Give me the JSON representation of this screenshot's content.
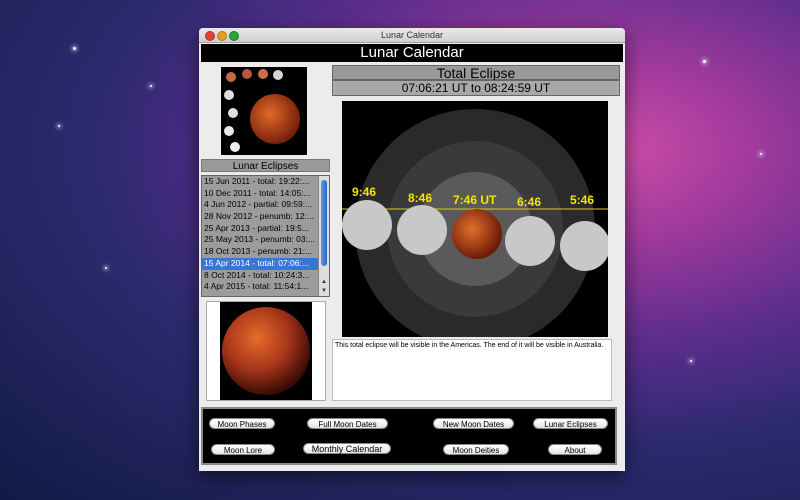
{
  "window": {
    "title": "Lunar Calendar"
  },
  "header": {
    "title": "Lunar Calendar"
  },
  "left": {
    "section_title": "Lunar Eclipses",
    "eclipses": [
      "15 Jun 2011 - total: 19:22:...",
      "10 Dec 2011 - total: 14:05:...",
      "4 Jun 2012 - partial: 09:59:...",
      "28 Nov 2012 - penumb: 12:...",
      "25 Apr 2013 - partial: 19:5...",
      "25 May 2013 - penumb: 03:...",
      "18 Oct 2013 - penumb: 21:...",
      "15 Apr 2014 - total: 07:06:...",
      "8 Oct 2014 - total: 10:24:3...",
      "4 Apr 2015 - total: 11:54:1..."
    ],
    "selected_index": 7
  },
  "eclipse": {
    "type_title": "Total Eclipse",
    "time_range": "07:06:21 UT to 08:24:59 UT",
    "time_labels": [
      "9:46",
      "8:46",
      "7:46 UT",
      "6:46",
      "5:46"
    ],
    "label_color": "#f5e500",
    "moon_color": "#c0521c",
    "description": "This total eclipse will be visible in the Americas. The end of it  will be visible in Australia."
  },
  "buttons": {
    "moon_phases": "Moon Phases",
    "full_moon_dates": "Full Moon Dates",
    "new_moon_dates": "New Moon Dates",
    "lunar_eclipses": "Lunar Eclipses",
    "moon_lore": "Moon Lore",
    "monthly_calendar": "Monthly Calendar",
    "moon_deities": "Moon Deities",
    "about": "About"
  }
}
